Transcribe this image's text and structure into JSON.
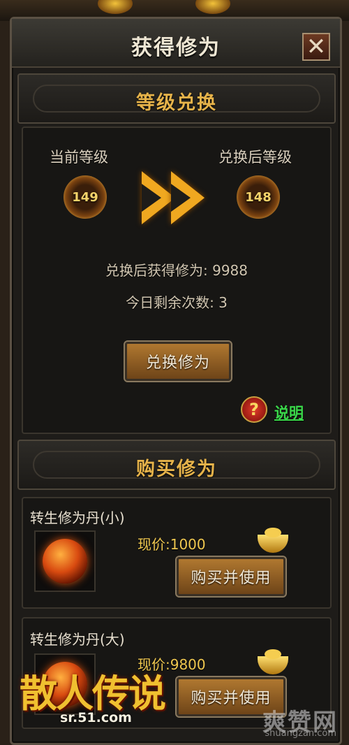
{
  "window": {
    "title": "获得修为",
    "close_label": "✕"
  },
  "exchange": {
    "header": "等级兑换",
    "current_label": "当前等级",
    "current_level": "149",
    "after_label": "兑换后等级",
    "after_level": "148",
    "gain_text": "兑换后获得修为: 9988",
    "remaining_text": "今日剩余次数: 3",
    "button_label": "兑换修为",
    "help_icon": "?",
    "help_label": "说明"
  },
  "buy": {
    "header": "购买修为",
    "items": [
      {
        "name": "转生修为丹(小)",
        "price_text": "现价:1000",
        "button_label": "购买并使用"
      },
      {
        "name": "转生修为丹(大)",
        "price_text": "现价:9800",
        "button_label": "购买并使用"
      }
    ]
  },
  "branding": {
    "logo": "散人传说",
    "url": "sr.51.com",
    "watermark": "爽赞网",
    "watermark_url": "shuangzan.com"
  },
  "colors": {
    "gold": "#e6b34a",
    "help_green": "#3ad84a",
    "button": "#b07830"
  }
}
